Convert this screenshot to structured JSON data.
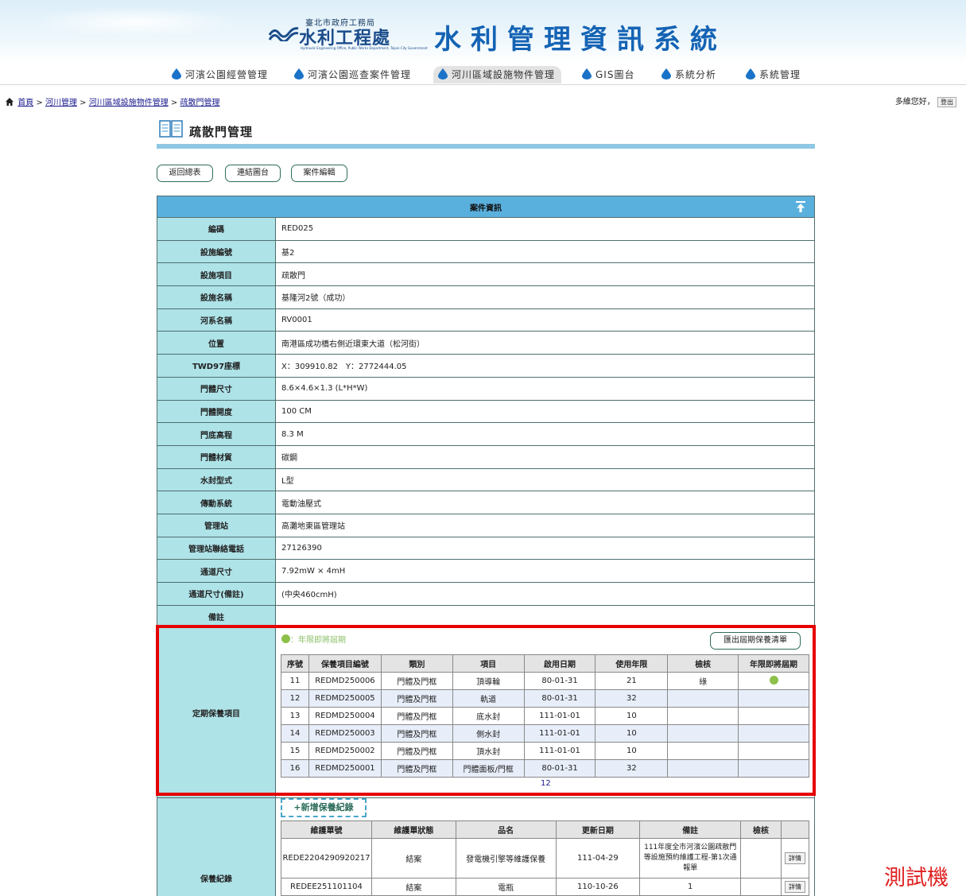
{
  "header": {
    "agency": "臺北市政府工務局",
    "org": "水利工程處",
    "org_en": "Hydraulic Engineering Office, Public Works Department, Taipei City Government",
    "system_title": "水利管理資訊系統"
  },
  "nav": [
    {
      "label": "河濱公園經營管理",
      "active": false
    },
    {
      "label": "河濱公園巡查案件管理",
      "active": false
    },
    {
      "label": "河川區域設施物件管理",
      "active": true
    },
    {
      "label": "GIS圖台",
      "active": false
    },
    {
      "label": "系統分析",
      "active": false
    },
    {
      "label": "系統管理",
      "active": false
    }
  ],
  "breadcrumb": {
    "items": [
      "首頁",
      "河川管理",
      "河川區域設施物件管理",
      "疏散門管理"
    ],
    "separator": ">"
  },
  "user": {
    "greeting": "多維您好，",
    "logout": "登出"
  },
  "page_title": "疏散門管理",
  "actions": {
    "back": "返回總表",
    "link_map": "連結圖台",
    "edit": "案件編輯"
  },
  "case_info": {
    "title": "案件資訊",
    "rows": [
      {
        "label": "編碼",
        "value": "RED025"
      },
      {
        "label": "設施編號",
        "value": "基2"
      },
      {
        "label": "設施項目",
        "value": "疏散門"
      },
      {
        "label": "設施名稱",
        "value": "基隆河2號（成功）"
      },
      {
        "label": "河系名稱",
        "value": "RV0001"
      },
      {
        "label": "位置",
        "value": "南港區成功橋右側近環東大道（松河街）"
      },
      {
        "label": "TWD97座標",
        "value": "X：309910.82　Y：2772444.05"
      },
      {
        "label": "門體尺寸",
        "value": "8.6×4.6×1.3 (L*H*W)"
      },
      {
        "label": "門體開度",
        "value": "100 CM"
      },
      {
        "label": "門底高程",
        "value": "8.3 M"
      },
      {
        "label": "門體材質",
        "value": "碳鋼"
      },
      {
        "label": "水封型式",
        "value": "L型"
      },
      {
        "label": "傳動系統",
        "value": "電動油壓式"
      },
      {
        "label": "管理站",
        "value": "高灘地東區管理站"
      },
      {
        "label": "管理站聯絡電話",
        "value": "27126390"
      },
      {
        "label": "通道尺寸",
        "value": "7.92mW × 4mH"
      },
      {
        "label": "通道尺寸(備註)",
        "value": "(中央460cmH)"
      },
      {
        "label": "備註",
        "value": ""
      }
    ]
  },
  "maintenance_items": {
    "label": "定期保養項目",
    "legend": "：年限即將屆期",
    "export_button": "匯出屆期保養清單",
    "columns": [
      "序號",
      "保養項目編號",
      "類別",
      "項目",
      "啟用日期",
      "使用年限",
      "檢核",
      "年限即將屆期"
    ],
    "rows": [
      {
        "no": "11",
        "code": "REDMD250006",
        "category": "門體及門框",
        "item": "頂導輪",
        "start": "80-01-31",
        "years": "21",
        "check": "綠",
        "expiring": true
      },
      {
        "no": "12",
        "code": "REDMD250005",
        "category": "門體及門框",
        "item": "軌道",
        "start": "80-01-31",
        "years": "32",
        "check": "",
        "expiring": false
      },
      {
        "no": "13",
        "code": "REDMD250004",
        "category": "門體及門框",
        "item": "底水封",
        "start": "111-01-01",
        "years": "10",
        "check": "",
        "expiring": false
      },
      {
        "no": "14",
        "code": "REDMD250003",
        "category": "門體及門框",
        "item": "側水封",
        "start": "111-01-01",
        "years": "10",
        "check": "",
        "expiring": false
      },
      {
        "no": "15",
        "code": "REDMD250002",
        "category": "門體及門框",
        "item": "頂水封",
        "start": "111-01-01",
        "years": "10",
        "check": "",
        "expiring": false
      },
      {
        "no": "16",
        "code": "REDMD250001",
        "category": "門體及門框",
        "item": "門體面板/門框",
        "start": "80-01-31",
        "years": "32",
        "check": "",
        "expiring": false
      }
    ],
    "pages": [
      "1",
      "2"
    ]
  },
  "maintenance_records": {
    "label": "保養紀錄",
    "add_button": "+新增保養紀錄",
    "columns": [
      "維護單號",
      "維護單狀態",
      "品名",
      "更新日期",
      "備註",
      "檢核",
      ""
    ],
    "rows": [
      {
        "id": "REDE2204290920217",
        "status": "結案",
        "name": "發電機引擎等維護保養",
        "date": "111-04-29",
        "note": "111年度全市河濱公園疏散門等設施預約維護工程-第1次通報單",
        "check": "",
        "action": "詳情"
      },
      {
        "id": "REDEE251101104",
        "status": "結案",
        "name": "電瓶",
        "date": "110-10-26",
        "note": "1",
        "check": "",
        "action": "詳情"
      }
    ]
  },
  "watermark": "測試機",
  "colors": {
    "header_bg": "#dceef9",
    "label_bg": "#aee3e8",
    "table_header": "#5ab0dd",
    "highlight": "#e60000",
    "accent_green": "#8cc04a"
  }
}
